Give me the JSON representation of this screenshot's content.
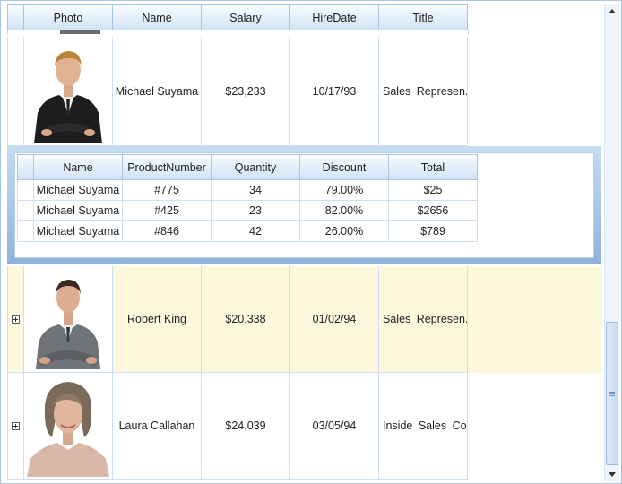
{
  "columns": {
    "photo": "Photo",
    "name": "Name",
    "salary": "Salary",
    "hire_date": "HireDate",
    "title": "Title"
  },
  "rows": [
    {
      "name": "Michael Suyama",
      "salary": "$23,233",
      "hire_date": "10/17/93",
      "title": "Sales Represen...",
      "expanded": true
    },
    {
      "name": "Robert King",
      "salary": "$20,338",
      "hire_date": "01/02/94",
      "title": "Sales Represen...",
      "selected": true
    },
    {
      "name": "Laura Callahan",
      "salary": "$24,039",
      "hire_date": "03/05/94",
      "title": "Inside Sales Co..."
    }
  ],
  "detail": {
    "columns": {
      "name": "Name",
      "product_number": "ProductNumber",
      "quantity": "Quantity",
      "discount": "Discount",
      "total": "Total"
    },
    "rows": [
      {
        "name": "Michael Suyama",
        "product_number": "#775",
        "quantity": "34",
        "discount": "79.00%",
        "total": "$25"
      },
      {
        "name": "Michael Suyama",
        "product_number": "#425",
        "quantity": "23",
        "discount": "82.00%",
        "total": "$2656"
      },
      {
        "name": "Michael Suyama",
        "product_number": "#846",
        "quantity": "42",
        "discount": "26.00%",
        "total": "$789"
      }
    ]
  },
  "icons": {
    "expand": "plus-box-icon",
    "scroll_up": "arrow-up-icon",
    "scroll_down": "arrow-down-icon",
    "scroll_grip": "grip-icon"
  },
  "colors": {
    "header_border": "#a6c4e6",
    "selected_row": "#fcf8dc",
    "detail_band": "#8fb2da"
  }
}
